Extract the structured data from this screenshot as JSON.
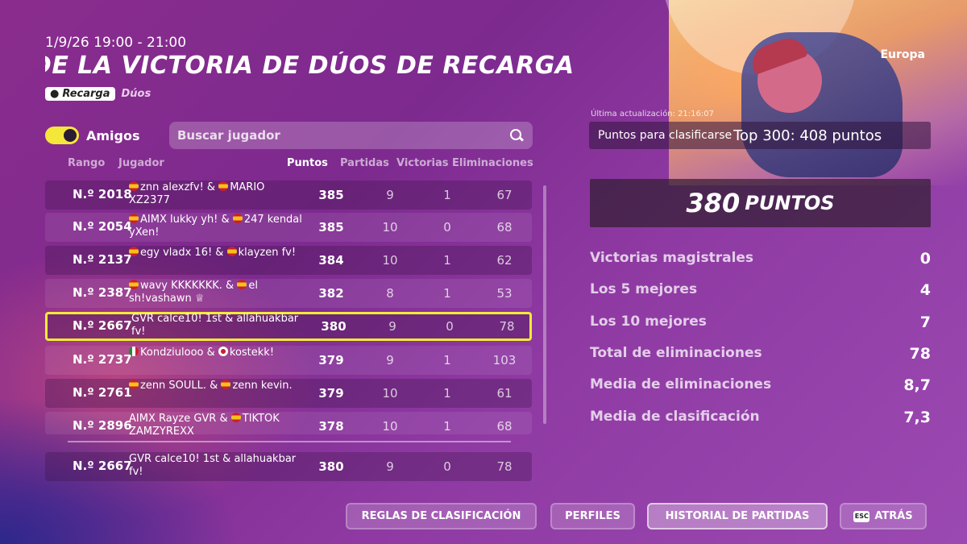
{
  "header": {
    "date": "1/9/26 19:00 - 21:00",
    "title": "COPA DE LA VICTORIA DE DÚOS DE RECARGA",
    "mode_tag": "Recarga",
    "mode_sub": "Dúos",
    "region": "Europa"
  },
  "filters": {
    "friends_label": "Amigos",
    "friends_on": true,
    "search_placeholder": "Buscar jugador"
  },
  "table": {
    "headers": {
      "rank": "Rango",
      "player": "Jugador",
      "points": "Puntos",
      "games": "Partidas",
      "wins": "Victorias",
      "elims": "Eliminaciones"
    },
    "rows": [
      {
        "rank": "N.º 2018",
        "p1_flag": "es",
        "p1": "znn alexzfv! & ",
        "p2_flag": "es",
        "p2": "MARIO XZ2377",
        "points": "385",
        "games": "9",
        "wins": "1",
        "elims": "67"
      },
      {
        "rank": "N.º 2054",
        "p1_flag": "es",
        "p1": "AIMX lukky yh! & ",
        "p2_flag": "es",
        "p2": "247 kendal yXen!",
        "points": "385",
        "games": "10",
        "wins": "0",
        "elims": "68"
      },
      {
        "rank": "N.º 2137",
        "p1_flag": "es",
        "p1": "egy vladx 16! & ",
        "p2_flag": "es",
        "p2": "klayzen fv!",
        "points": "384",
        "games": "10",
        "wins": "1",
        "elims": "62"
      },
      {
        "rank": "N.º 2387",
        "p1_flag": "es",
        "p1": "wavy KKKKKKK. & ",
        "p2_flag": "es",
        "p2": "el sh!vashawn ♕",
        "points": "382",
        "games": "8",
        "wins": "1",
        "elims": "53"
      },
      {
        "rank": "N.º 2667",
        "p1_flag": "",
        "p1": "GVR calce10! 1st & ",
        "p2_flag": "",
        "p2": "allahuakbar fv!",
        "points": "380",
        "games": "9",
        "wins": "0",
        "elims": "78"
      },
      {
        "rank": "N.º 2737",
        "p1_flag": "mx",
        "p1": "Kondziulooo & ",
        "p2_flag": "jp",
        "p2": "kostekk!",
        "points": "379",
        "games": "9",
        "wins": "1",
        "elims": "103"
      },
      {
        "rank": "N.º 2761",
        "p1_flag": "es",
        "p1": "zenn SOULL. & ",
        "p2_flag": "es",
        "p2": "zenn kevin.",
        "points": "379",
        "games": "10",
        "wins": "1",
        "elims": "61"
      },
      {
        "rank": "N.º 2896",
        "p1_flag": "",
        "p1": "AIMX Rayze GVR & ",
        "p2_flag": "es",
        "p2": "TIKTOK ZAMZYREXX",
        "points": "378",
        "games": "10",
        "wins": "1",
        "elims": "68"
      }
    ],
    "self_row": {
      "rank": "N.º 2667",
      "p1": "GVR calce10! 1st & ",
      "p2": "allahuakbar fv!",
      "points": "380",
      "games": "9",
      "wins": "0",
      "elims": "78"
    }
  },
  "summary": {
    "last_update": "Última actualización: 21:16:07",
    "qual_label": "Puntos para clasificarse",
    "qual_value": "Top 300: 408 puntos",
    "points_value": "380",
    "points_unit": "PUNTOS",
    "stats": [
      {
        "label": "Victorias magistrales",
        "value": "0"
      },
      {
        "label": "Los 5 mejores",
        "value": "4"
      },
      {
        "label": "Los 10 mejores",
        "value": "7"
      },
      {
        "label": "Total de eliminaciones",
        "value": "78"
      },
      {
        "label": "Media de eliminaciones",
        "value": "8,7"
      },
      {
        "label": "Media de clasificación",
        "value": "7,3"
      }
    ]
  },
  "footer": {
    "rules_label": "REGLAS DE CLASIFICACIÓN",
    "profiles_label": "PERFILES",
    "history_label": "HISTORIAL DE PARTIDAS",
    "esc_key": "ESC",
    "back_label": "ATRÁS"
  },
  "colors": {
    "highlight": "#f2ea39",
    "toggle": "#f5e63a"
  }
}
